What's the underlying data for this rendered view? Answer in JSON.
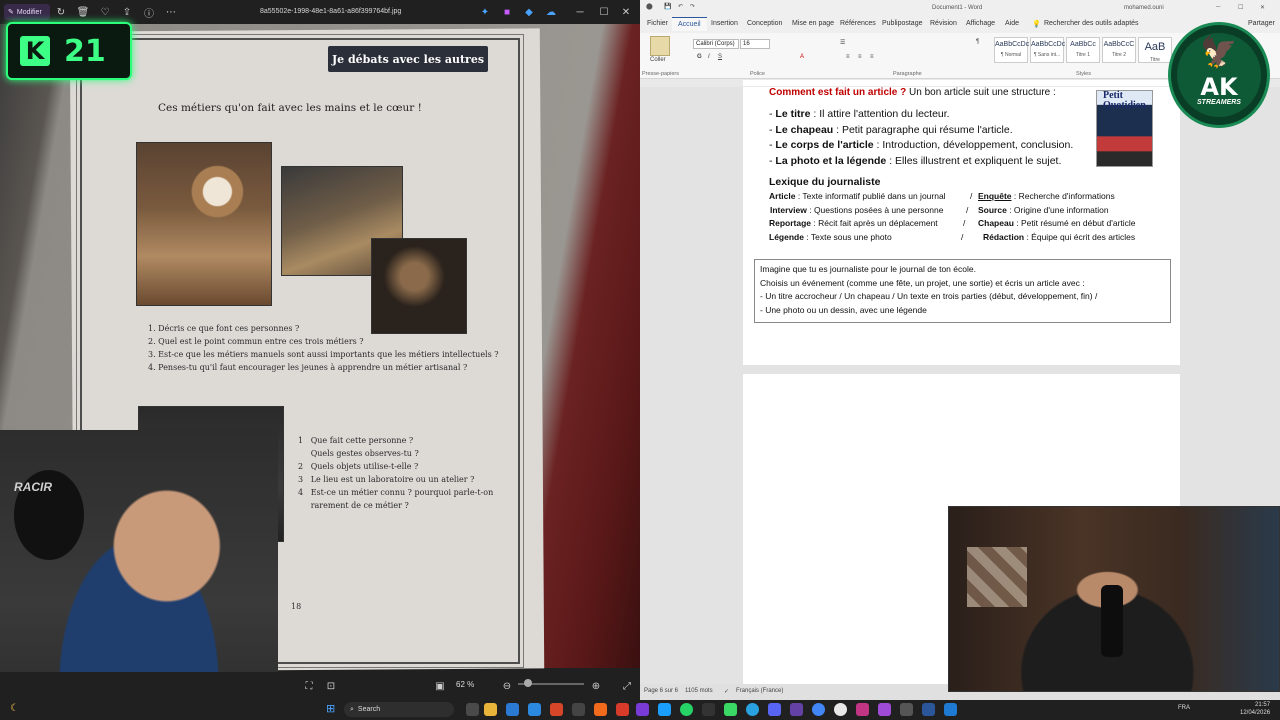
{
  "viewer": {
    "edit_label": "Modifier",
    "filename": "8a55502e-1998-48e1-8a61-a86f399764bf.jpg",
    "zoom": "62 %",
    "page": {
      "banner": "Je débats avec les autres",
      "heading": "Ces métiers qu'on fait avec les mains et le cœur !",
      "questions1": [
        "1.  Décris ce que  font ces personnes ?",
        "2.  Quel est le point commun entre ces trois métiers ?",
        "3.  Est-ce que les métiers manuels sont aussi importants que les métiers intellectuels ?",
        "4.  Penses-tu qu'il faut encourager les jeunes à apprendre un métier artisanal ?"
      ],
      "questions2": [
        "1   Que fait cette personne ?",
        "     Quels gestes observes-tu ?",
        "2   Quels objets utilise-t-elle ?",
        "3   Le lieu est un laboratoire ou un atelier ?",
        "4   Est-ce un métier connu ? pourquoi parle-t-on",
        "     rarement de ce métier ?"
      ],
      "page_number": "18"
    }
  },
  "badge": {
    "k": "K",
    "number": "21"
  },
  "cam1": {
    "brand": "RACIR"
  },
  "word": {
    "title": "Document1 - Word",
    "user": "mohamed.ouni",
    "tabs": [
      "Fichier",
      "Accueil",
      "Insertion",
      "Conception",
      "Mise en page",
      "Références",
      "Publipostage",
      "Révision",
      "Affichage",
      "Aide",
      "Rechercher des outils adaptés"
    ],
    "share": "Partager",
    "ribbon": {
      "paste": "Coller",
      "clipboard": "Presse-papiers",
      "font": "Calibri (Corps)",
      "size": "16",
      "police": "Police",
      "paragraph": "Paragraphe",
      "styles_label": "Styles",
      "styles": [
        {
          "preview": "AaBbCcDc",
          "name": "¶ Normal"
        },
        {
          "preview": "AaBbCcDc",
          "name": "¶ Sans int..."
        },
        {
          "preview": "AaBbCc",
          "name": "Titre 1"
        },
        {
          "preview": "AaBbCcC",
          "name": "Titre 2"
        },
        {
          "preview": "AaB",
          "name": "Titre"
        }
      ]
    },
    "doc": {
      "heading_red": "Comment est fait un article ?",
      "heading_rest": " Un bon article suit une structure :",
      "bullets": [
        {
          "b": "Le titre",
          "t": " : Il attire l'attention du lecteur."
        },
        {
          "b": "Le chapeau",
          "t": " : Petit paragraphe qui résume l'article."
        },
        {
          "b": "Le corps de l'article",
          "t": " : Introduction, développement, conclusion."
        },
        {
          "b": "La photo et la légende",
          "t": " : Elles illustrent et expliquent le sujet."
        }
      ],
      "lexique_title": "Lexique du journaliste",
      "lexique": [
        {
          "a": "Article",
          "at": " : Texte informatif publié dans un journal",
          "sep": " /  ",
          "b": "Enquête",
          "bt": " : Recherche d'informations"
        },
        {
          "a": "Interview",
          "at": " : Questions posées à une personne",
          "sep": "   /   ",
          "b": "Source",
          "bt": " : Origine d'une information"
        },
        {
          "a": "Reportage",
          "at": " : Récit fait après un déplacement",
          "sep": "   /   ",
          "b": "Chapeau",
          "bt": " : Petit résumé en début d'article"
        },
        {
          "a": "Légende",
          "at": " : Texte sous une photo",
          "sep": "                   /   ",
          "b": "Rédaction",
          "bt": " : Équipe qui écrit des articles"
        }
      ],
      "box_lines": [
        "Imagine que tu es journaliste pour le journal de ton école.",
        "Choisis un événement (comme une fête, un projet, une sortie) et écris un article avec :",
        "- Un titre accrocheur / Un chapeau / Un texte en trois parties (début, développement, fin) /",
        "- Une photo ou un dessin, avec une légende"
      ],
      "newspaper_title": "Petit Quotidien"
    },
    "status": {
      "page": "Page 6 sur 6",
      "words": "1105 mots",
      "lang": "Français (France)"
    }
  },
  "ak_logo": {
    "letters": "AK",
    "sub": "STREAMERS"
  },
  "taskbar": {
    "search": "Search",
    "lang": "FRA",
    "time": "21:57",
    "date": "12/04/2026"
  },
  "colors": {
    "badge_green": "#3dff86",
    "word_blue": "#2b579a",
    "heading_red": "#c00000",
    "ak_green": "#0f5a36"
  }
}
